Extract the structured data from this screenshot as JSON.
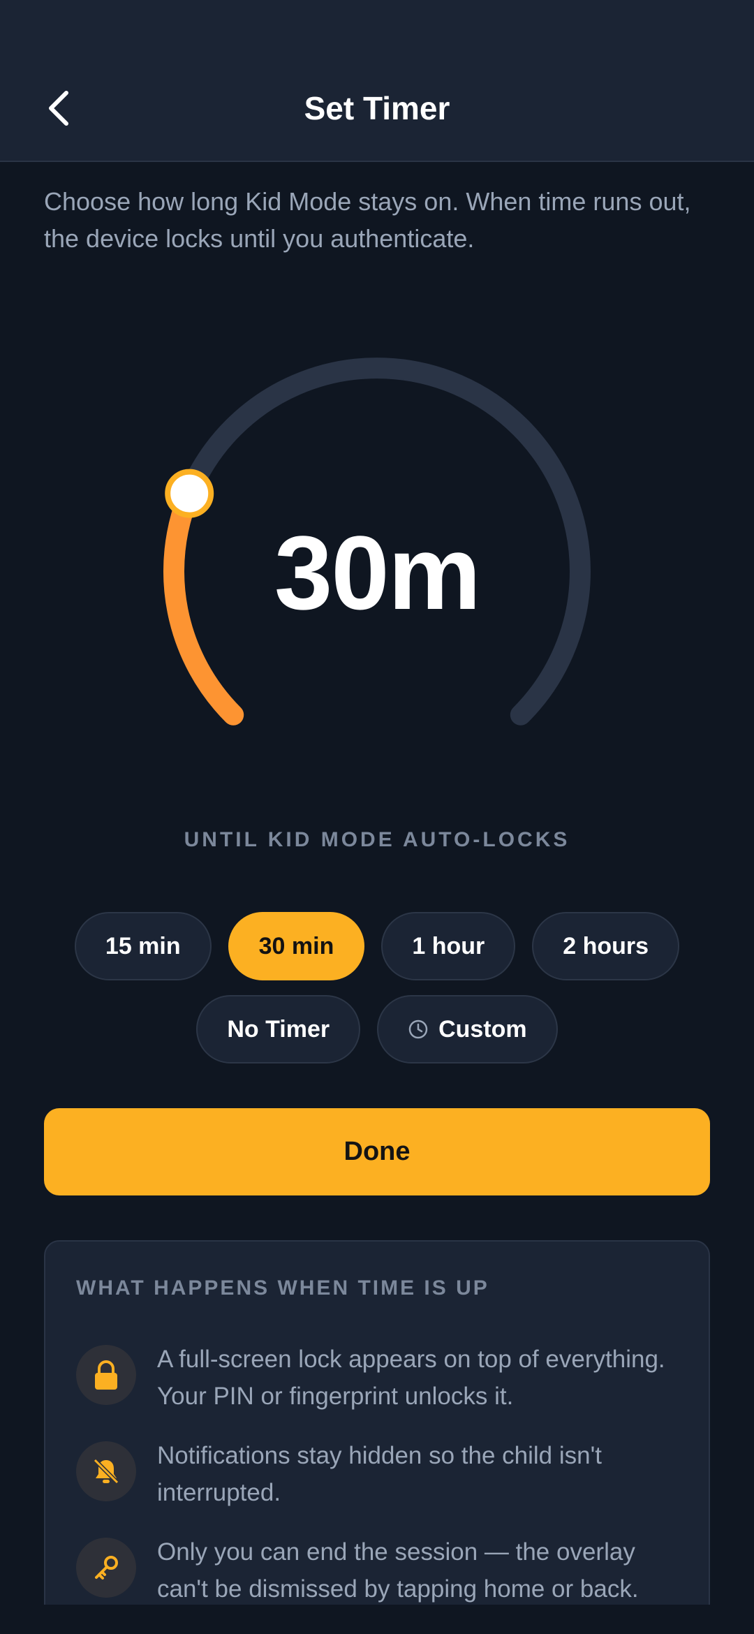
{
  "header": {
    "title": "Set Timer",
    "back_icon": "chevron-left-icon"
  },
  "description": "Choose how long Kid Mode stays on. When time runs out, the device locks until you authenticate.",
  "dial": {
    "value": "30m",
    "caption": "UNTIL KID MODE AUTO-LOCKS",
    "progress_fraction": 0.25,
    "track_color": "#2a3446",
    "fill_color": "#fd9432"
  },
  "presets": [
    {
      "label": "15 min",
      "active": false
    },
    {
      "label": "30 min",
      "active": true
    },
    {
      "label": "1 hour",
      "active": false
    },
    {
      "label": "2 hours",
      "active": false
    },
    {
      "label": "No Timer",
      "active": false
    },
    {
      "label": "Custom",
      "active": false,
      "icon": "clock-icon"
    }
  ],
  "done_label": "Done",
  "info": {
    "heading": "WHAT HAPPENS WHEN TIME IS UP",
    "items": [
      {
        "icon": "lock-icon",
        "text": "A full-screen lock appears on top of everything. Your PIN or fingerprint unlocks it."
      },
      {
        "icon": "bell-off-icon",
        "text": "Notifications stay hidden so the child isn't interrupted."
      },
      {
        "icon": "key-icon",
        "text": "Only you can end the session — the overlay can't be dismissed by tapping home or back."
      }
    ]
  },
  "colors": {
    "accent": "#fcb022",
    "background": "#0f1621",
    "surface": "#1b2434"
  }
}
